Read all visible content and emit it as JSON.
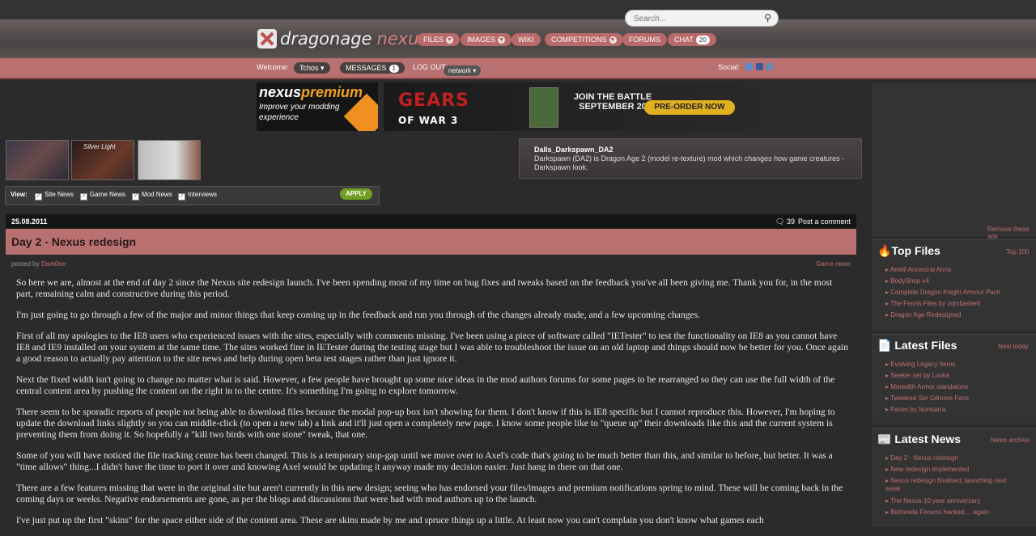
{
  "search": {
    "placeholder": "Search..."
  },
  "logo": {
    "brand": "dragonage",
    "brand2": "nexus"
  },
  "nav": [
    {
      "label": "FILES"
    },
    {
      "label": "IMAGES"
    },
    {
      "label": "WIKI"
    },
    {
      "label": "COMPETITIONS"
    },
    {
      "label": "FORUMS"
    },
    {
      "label": "CHAT",
      "count": "20"
    }
  ],
  "userbar": {
    "welcome": "Welcome:",
    "user": "Tchos",
    "messages": "MESSAGES",
    "messages_count": "1",
    "logout": "LOG OUT",
    "network": "network",
    "social": "Social:"
  },
  "premium": {
    "line1a": "nexus",
    "line1b": "premium",
    "line2": "Improve your modding experience"
  },
  "gears_ad": {
    "logo": "GEARS",
    "logo2": "OF WAR 3",
    "join": "JOIN THE BATTLE SEPTEMBER 20",
    "cta": "PRE-ORDER NOW"
  },
  "featured": {
    "title": "Dalls_Darkspawn_DA2",
    "desc": "Darkspawn (DA2) is Dragon Age 2 (model re-texture) mod which changes how game creatures - Darkspawn look."
  },
  "thumbs": [
    {
      "label": ""
    },
    {
      "label": "Silver Light"
    },
    {
      "label": ""
    }
  ],
  "view": {
    "label": "View:",
    "options": [
      "Site News",
      "Game News",
      "Mod News",
      "Interviews"
    ],
    "apply": "APPLY"
  },
  "article": {
    "date": "25.08.2011",
    "comments": "39",
    "post_comment": "Post a comment",
    "title": "Day 2 - Nexus redesign",
    "posted_by": "posted by",
    "author": "Dark0ne",
    "category": "Game news",
    "paragraphs": [
      "So here we are, almost at the end of day 2 since the Nexus site redesign launch. I've been spending most of my time on bug fixes and tweaks based on the feedback you've all been giving me. Thank you for, in the most part, remaining calm and constructive during this period.",
      "I'm just going to go through a few of the major and minor things that keep coming up in the feedback and run you through of the changes already made, and a few upcoming changes.",
      "First of all my apologies to the IE8 users who experienced issues with the sites, especially with comments missing. I've been using a piece of software called \"IETester\" to test the functionality on IE8 as you cannot have IE8 and IE9 installed on your system at the same time. The sites worked fine in IETester during the testing stage but I was able to troubleshoot the issue on an old laptop and things should now be better for you. Once again a good reason to actually pay attention to the site news and help during open beta test stages rather than just ignore it.",
      "Next the fixed width isn't going to change no matter what is said. However, a few people have brought up some nice ideas in the mod authors forums for some pages to be rearranged so they can use the full width of the central content area by pushing the content on the right in to the centre. It's something I'm going to explore tomorrow.",
      "There seem to be sporadic reports of people not being able to download files because the modal pop-up box isn't showing for them. I don't know if this is IE8 specific but I cannot reproduce this. However, I'm hoping to update the download links slightly so you can middle-click (to open a new tab) a link and it'll just open a completely new page. I know some people like to \"queue up\" their downloads like this and the current system is preventing them from doing it. So hopefully a \"kill two birds with one stone\" tweak, that one.",
      "Some of you will have noticed the file tracking centre has been changed. This is a temporary stop-gap until we move over to Axel's code that's going to be much better than this, and similar to before, but better. It was a \"time allows\" thing...I didn't have the time to port it over and knowing Axel would be updating it anyway made my decision easier. Just hang in there on that one.",
      "There are a few features missing that were in the original site but aren't currently in this new design; seeing who has endorsed your files/images and premium notifications spring to mind. These will be coming back in the coming days or weeks. Negative endorsements are gone, as per the blogs and discussions that were had with mod authors up to the launch.",
      "I've just put up the first \"skins\" for the space either side of the content area. These are skins made by me and spruce things up a little. At least now you can't complain you don't know what games each"
    ]
  },
  "sidebar": {
    "remove_ads": "Remove these ads",
    "top_files": {
      "title": "Top Files",
      "link": "Top 100",
      "items": [
        "Amell Ancestral Arms",
        "BodyShop v4",
        "Complete Dragon Knight Armour Pack",
        "The Fenris Files by zombasteril",
        "Dragon Age Redesigned"
      ]
    },
    "latest_files": {
      "title": "Latest Files",
      "link": "New today",
      "items": [
        "Evolving Legacy Items",
        "Seeker set by Looka",
        "Meredith Armor standalone",
        "Tweaked Ser Gilmore Face",
        "Faces by Norstarra"
      ]
    },
    "latest_news": {
      "title": "Latest News",
      "link": "News archive",
      "items": [
        "Day 2 - Nexus redesign",
        "New redesign implemented",
        "Nexus redesign finalised, launching next week",
        "The Nexus 10 year anniversary",
        "Bethesda Forums hacked.... again"
      ]
    }
  }
}
